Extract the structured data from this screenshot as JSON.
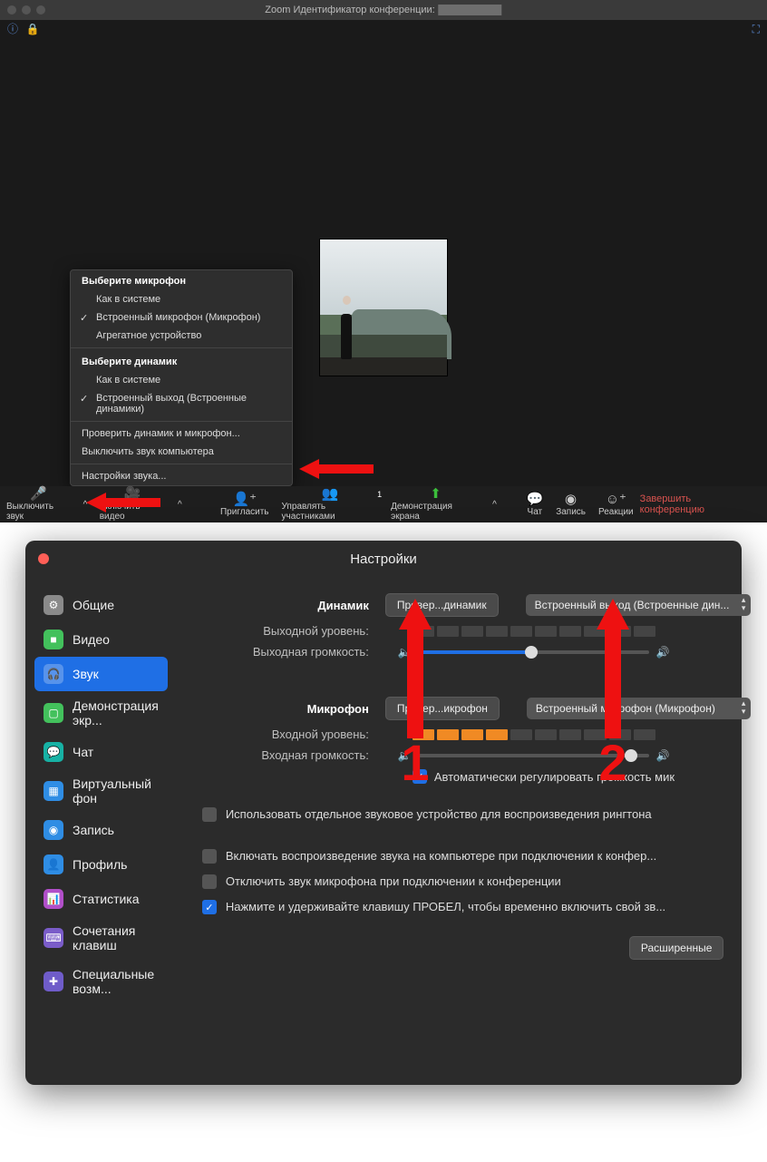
{
  "win1": {
    "title_prefix": "Zoom Идентификатор конференции:",
    "menu": {
      "mic_header": "Выберите микрофон",
      "mic_items": [
        "Как в системе",
        "Встроенный микрофон (Микрофон)",
        "Агрегатное устройство"
      ],
      "mic_checked_index": 1,
      "spk_header": "Выберите динамик",
      "spk_items": [
        "Как в системе",
        "Встроенный выход (Встроенные динамики)"
      ],
      "spk_checked_index": 1,
      "extra": [
        "Проверить динамик и микрофон...",
        "Выключить звук компьютера"
      ],
      "settings": "Настройки звука..."
    },
    "toolbar": {
      "mute": "Выключить звук",
      "video": "Включить видео",
      "invite": "Пригласить",
      "participants": "Управлять участниками",
      "participants_count": "1",
      "share": "Демонстрация экрана",
      "chat": "Чат",
      "record": "Запись",
      "reactions": "Реакции",
      "end": "Завершить конференцию"
    }
  },
  "win2": {
    "title": "Настройки",
    "sidebar": [
      {
        "label": "Общие",
        "color": "#8a8a8a",
        "glyph": "⚙"
      },
      {
        "label": "Видео",
        "color": "#43c15c",
        "glyph": "■"
      },
      {
        "label": "Звук",
        "color": "#1f6fe5",
        "glyph": "🎧",
        "active": true
      },
      {
        "label": "Демонстрация экр...",
        "color": "#43c15c",
        "glyph": "▢"
      },
      {
        "label": "Чат",
        "color": "#17b1a4",
        "glyph": "💬"
      },
      {
        "label": "Виртуальный фон",
        "color": "#2f8de4",
        "glyph": "▦"
      },
      {
        "label": "Запись",
        "color": "#2f8de4",
        "glyph": "◉"
      },
      {
        "label": "Профиль",
        "color": "#2f8de4",
        "glyph": "👤"
      },
      {
        "label": "Статистика",
        "color": "#b14fc9",
        "glyph": "📊"
      },
      {
        "label": "Сочетания клавиш",
        "color": "#7a5cc9",
        "glyph": "⌨"
      },
      {
        "label": "Специальные возм...",
        "color": "#6f5cc9",
        "glyph": "✚"
      }
    ],
    "speaker": {
      "label": "Динамик",
      "test_btn": "Провер...динамик",
      "device": "Встроенный выход (Встроенные дин...",
      "out_level": "Выходной уровень:",
      "out_volume": "Выходная громкость:",
      "volume_pct": 49
    },
    "mic": {
      "label": "Микрофон",
      "test_btn": "Провер...икрофон",
      "device": "Встроенный микрофон (Микрофон)",
      "in_level": "Входной уровень:",
      "in_volume": "Входная громкость:",
      "level_segments_on": 4,
      "level_segments_total": 10,
      "volume_pct": 92,
      "auto": "Автоматически регулировать громкость мик"
    },
    "opts": {
      "ringtone": "Использовать отдельное звуковое устройство для воспроизведения рингтона",
      "join_audio": "Включать воспроизведение звука на компьютере при подключении к конфер...",
      "mute_on_join": "Отключить звук микрофона при подключении к конференции",
      "push_to_talk": "Нажмите и удерживайте клавишу ПРОБЕЛ, чтобы временно включить свой зв..."
    },
    "advanced": "Расширенные",
    "annot": {
      "n1": "1",
      "n2": "2"
    }
  }
}
